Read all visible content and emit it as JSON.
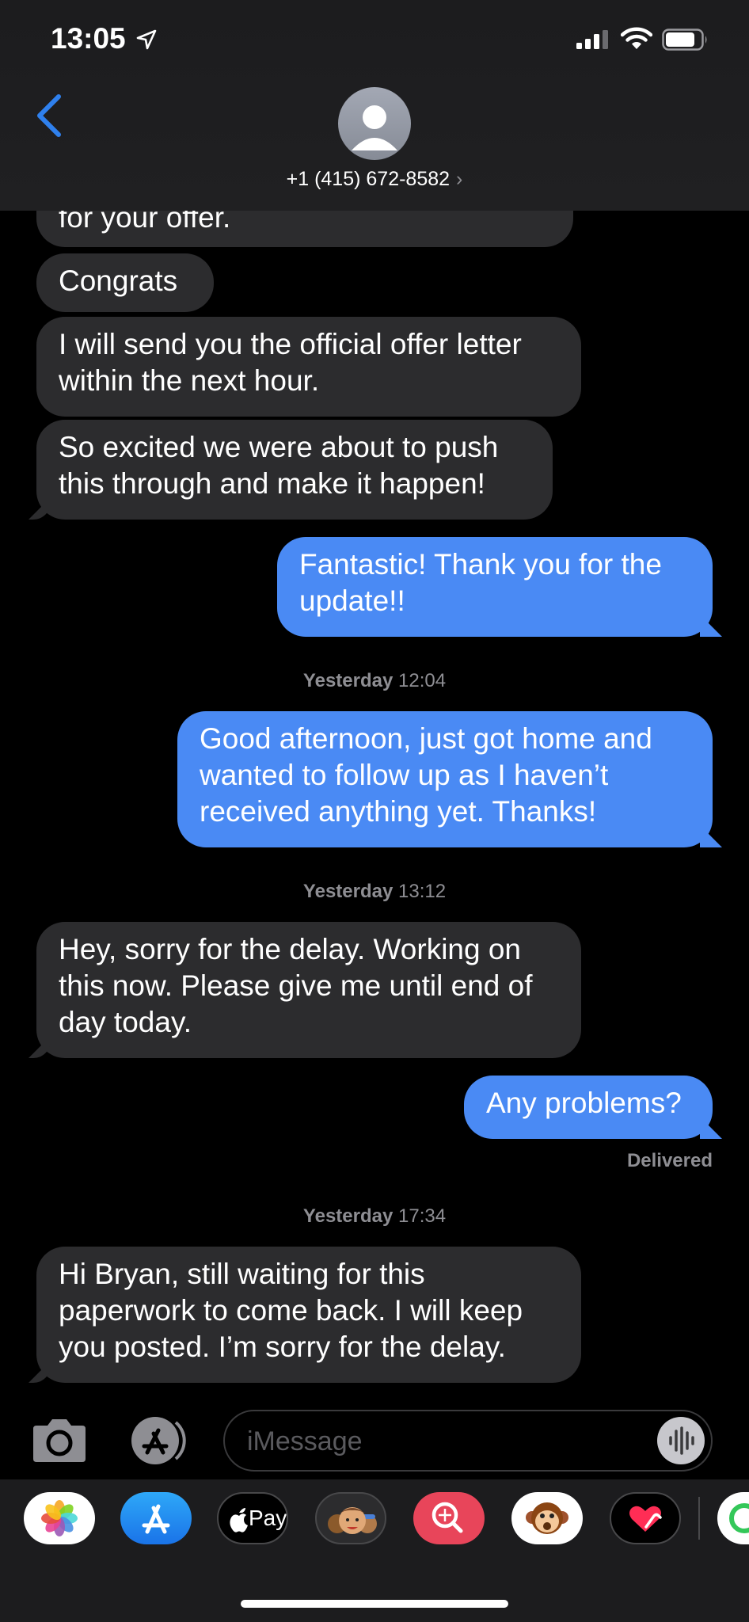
{
  "status_bar": {
    "time": "13:05"
  },
  "header": {
    "contact": "+1 (415) 672-8582"
  },
  "messages": [
    {
      "text": "for your offer."
    },
    {
      "text": "Congrats"
    },
    {
      "text": "I will send you the official offer letter within the next hour."
    },
    {
      "text": "So excited we were about to push this through and make it happen!"
    },
    {
      "text": "Fantastic! Thank you for the update!!"
    },
    {
      "text": "Good afternoon, just got home and wanted to follow up as I haven’t received anything yet. Thanks!"
    },
    {
      "text": "Hey, sorry for the delay. Working on this now. Please give me until end of day today."
    },
    {
      "text": "Any problems?"
    },
    {
      "text": "Hi Bryan, still waiting for this paperwork to come back. I will keep you posted. I’m sorry for the delay."
    }
  ],
  "timestamps": [
    {
      "day": "Yesterday",
      "time": "12:04"
    },
    {
      "day": "Yesterday",
      "time": "13:12"
    },
    {
      "day": "Yesterday",
      "time": "17:34"
    }
  ],
  "delivery_status": "Delivered",
  "input": {
    "placeholder": "iMessage"
  },
  "app_drawer": {
    "apps": [
      "photos-icon",
      "app-store-icon",
      "apple-pay-icon",
      "memoji-icon",
      "image-search-icon",
      "animoji-icon",
      "digital-touch-icon"
    ],
    "apple_pay_label": "Pay"
  },
  "colors": {
    "outgoing": "#4a8af4",
    "incoming": "#2c2c2e",
    "accent": "#2f80ed"
  }
}
